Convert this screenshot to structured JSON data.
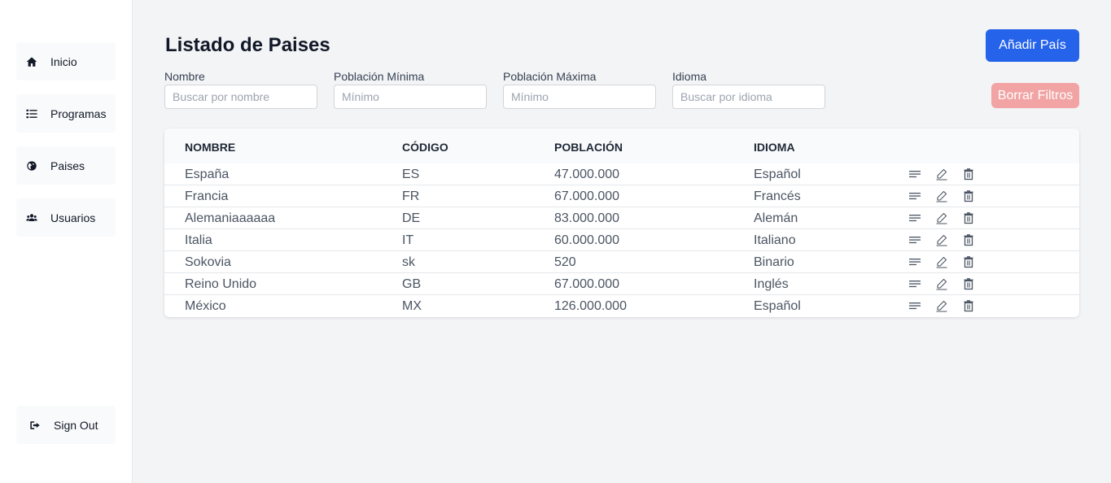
{
  "sidebar": {
    "items": [
      {
        "label": "Inicio",
        "icon": "home-icon"
      },
      {
        "label": "Programas",
        "icon": "list-icon"
      },
      {
        "label": "Paises",
        "icon": "globe-icon"
      },
      {
        "label": "Usuarios",
        "icon": "users-icon"
      }
    ],
    "signout": {
      "label": "Sign Out",
      "icon": "sign-out-icon"
    }
  },
  "header": {
    "title": "Listado de Paises",
    "add_label": "Añadir País",
    "clear_label": "Borrar Filtros"
  },
  "filters": {
    "nombre": {
      "label": "Nombre",
      "placeholder": "Buscar por nombre",
      "value": ""
    },
    "min": {
      "label": "Población Mínima",
      "placeholder": "Mínimo",
      "value": ""
    },
    "max": {
      "label": "Población Máxima",
      "placeholder": "Mínimo",
      "value": ""
    },
    "idioma": {
      "label": "Idioma",
      "placeholder": "Buscar por idioma",
      "value": ""
    }
  },
  "table": {
    "headers": [
      "NOMBRE",
      "CÓDIGO",
      "POBLACIÓN",
      "IDIOMA"
    ],
    "rows": [
      [
        "España",
        "ES",
        "47.000.000",
        "Español"
      ],
      [
        "Francia",
        "FR",
        "67.000.000",
        "Francés"
      ],
      [
        "Alemaniaaaaaa",
        "DE",
        "83.000.000",
        "Alemán"
      ],
      [
        "Italia",
        "IT",
        "60.000.000",
        "Italiano"
      ],
      [
        "Sokovia",
        "sk",
        "520",
        "Binario"
      ],
      [
        "Reino Unido",
        "GB",
        "67.000.000",
        "Inglés"
      ],
      [
        "México",
        "MX",
        "126.000.000",
        "Español"
      ]
    ],
    "row_actions": [
      "details-icon",
      "edit-icon",
      "delete-icon"
    ]
  },
  "colors": {
    "primary": "#2563eb",
    "danger_disabled": "#f2a3a3",
    "background": "#f3f4f6"
  }
}
